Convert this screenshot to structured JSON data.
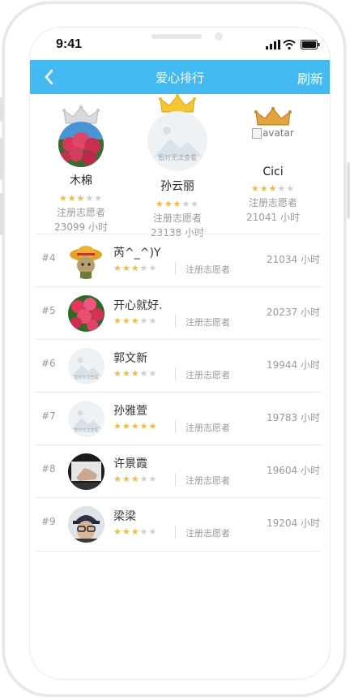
{
  "status": {
    "time": "9:41"
  },
  "nav": {
    "title": "爱心排行",
    "refresh_label": "刷新",
    "color": "#45b9f2"
  },
  "podium": {
    "second": {
      "name": "木棉",
      "type": "注册志愿者",
      "hours": "23099 小时",
      "stars": 3
    },
    "first": {
      "name": "孙云丽",
      "type": "注册志愿者",
      "hours": "23138 小时",
      "stars": 3,
      "avatar_text": "暂时无法查看"
    },
    "third": {
      "name": "Cici",
      "type": "注册志愿者",
      "hours": "21041 小时",
      "stars": 3,
      "avatar_alt": "avatar"
    }
  },
  "list": [
    {
      "rank": "#4",
      "name": "芮^_^)Y",
      "type": "注册志愿者",
      "hours": "21034 小时",
      "stars": 3,
      "avatar": "straw-hat"
    },
    {
      "rank": "#5",
      "name": "开心就好.",
      "type": "注册志愿者",
      "hours": "20237 小时",
      "stars": 3,
      "avatar": "flowers"
    },
    {
      "rank": "#6",
      "name": "郭文新",
      "type": "注册志愿者",
      "hours": "19944 小时",
      "stars": 3,
      "avatar": "placeholder",
      "avatar_text": "暂时无法查看"
    },
    {
      "rank": "#7",
      "name": "孙雅萱",
      "type": "注册志愿者",
      "hours": "19783 小时",
      "stars": 5,
      "avatar": "placeholder",
      "avatar_text": "暂时无法查看"
    },
    {
      "rank": "#8",
      "name": "许景霞",
      "type": "注册志愿者",
      "hours": "19604 小时",
      "stars": 3,
      "avatar": "hand"
    },
    {
      "rank": "#9",
      "name": "梁梁",
      "type": "注册志愿者",
      "hours": "19204 小时",
      "stars": 3,
      "avatar": "person-cap"
    }
  ]
}
